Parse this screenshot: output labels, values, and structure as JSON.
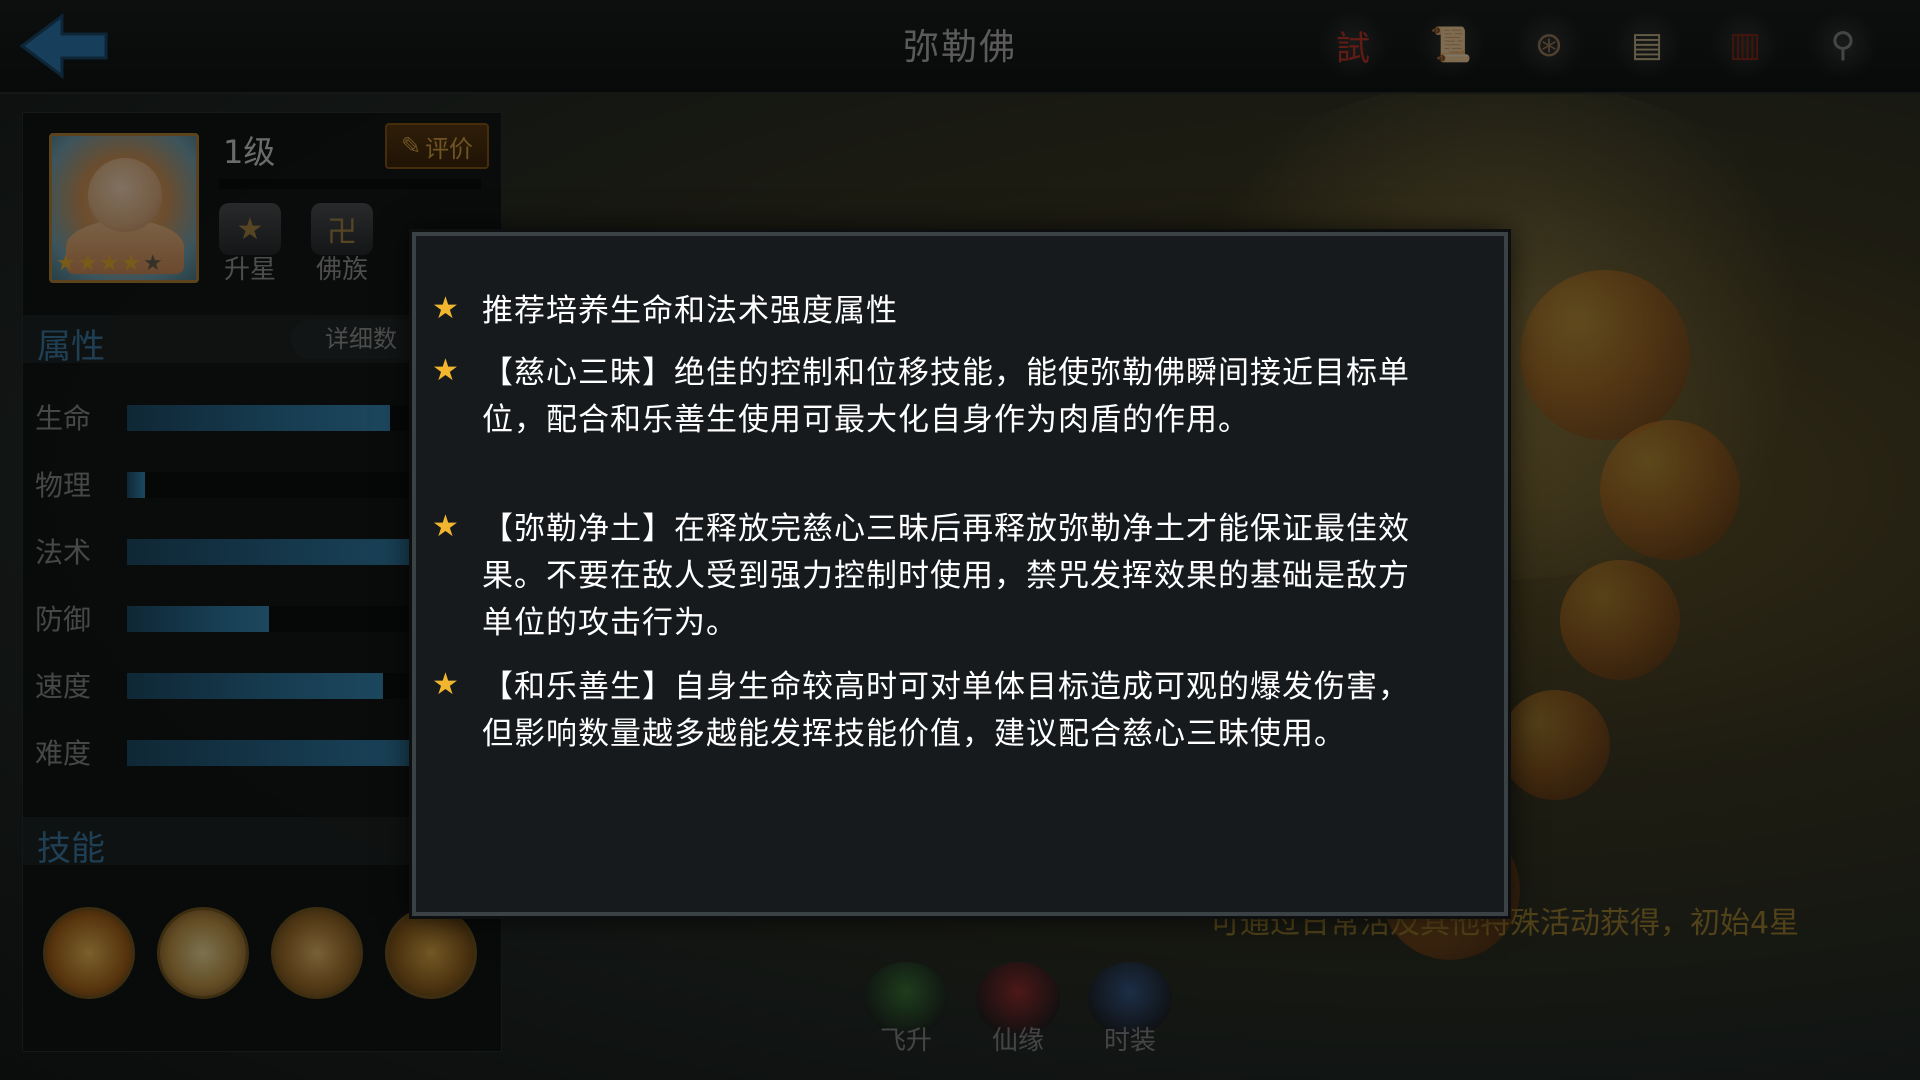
{
  "header": {
    "title": "弥勒佛",
    "top_icons": [
      {
        "name": "trial-icon",
        "glyph": "試"
      },
      {
        "name": "scroll-icon",
        "glyph": "📜"
      },
      {
        "name": "coin-icon",
        "glyph": "⊛"
      },
      {
        "name": "document-icon",
        "glyph": "▤"
      },
      {
        "name": "book-icon",
        "glyph": "▥"
      },
      {
        "name": "magnifier-icon",
        "glyph": "⚲"
      }
    ]
  },
  "hero": {
    "level": "1级",
    "rate_label": "评价",
    "stars_on": 4,
    "stars_total": 5,
    "badges": [
      {
        "label": "升星",
        "glyph": "★"
      },
      {
        "label": "佛族",
        "glyph": "卍"
      }
    ]
  },
  "attributes": {
    "title": "属性",
    "detail_label": "详细数",
    "items": [
      {
        "label": "生命",
        "fraction": 0.74
      },
      {
        "label": "物理",
        "fraction": 0.05
      },
      {
        "label": "法术",
        "fraction": 1.0
      },
      {
        "label": "防御",
        "fraction": 0.4
      },
      {
        "label": "速度",
        "fraction": 0.72
      },
      {
        "label": "难度",
        "fraction": 1.0
      }
    ]
  },
  "skills": {
    "title": "技能"
  },
  "bottom_buttons": [
    {
      "label": "飞升",
      "color": "#3d7a3a"
    },
    {
      "label": "仙缘",
      "color": "#9a3030"
    },
    {
      "label": "时装",
      "color": "#3a5c8e"
    }
  ],
  "acquire_text": "可通过日常活及其他特殊活动获得，初始4星",
  "tips": [
    "推荐培养生命和法术强度属性",
    "【慈心三昧】绝佳的控制和位移技能，能使弥勒佛瞬间接近目标单位，配合和乐善生使用可最大化自身作为肉盾的作用。",
    "【弥勒净土】在释放完慈心三昧后再释放弥勒净土才能保证最佳效果。不要在敌人受到强力控制时使用，禁咒发挥效果的基础是敌方单位的攻击行为。",
    "【和乐善生】自身生命较高时可对单体目标造成可观的爆发伤害，但影响数量越多越能发挥技能价值，建议配合慈心三昧使用。"
  ],
  "colors": {
    "accent_blue": "#3f7ea8",
    "star_gold": "#f1b52e",
    "rate_orange": "#e0a645"
  }
}
